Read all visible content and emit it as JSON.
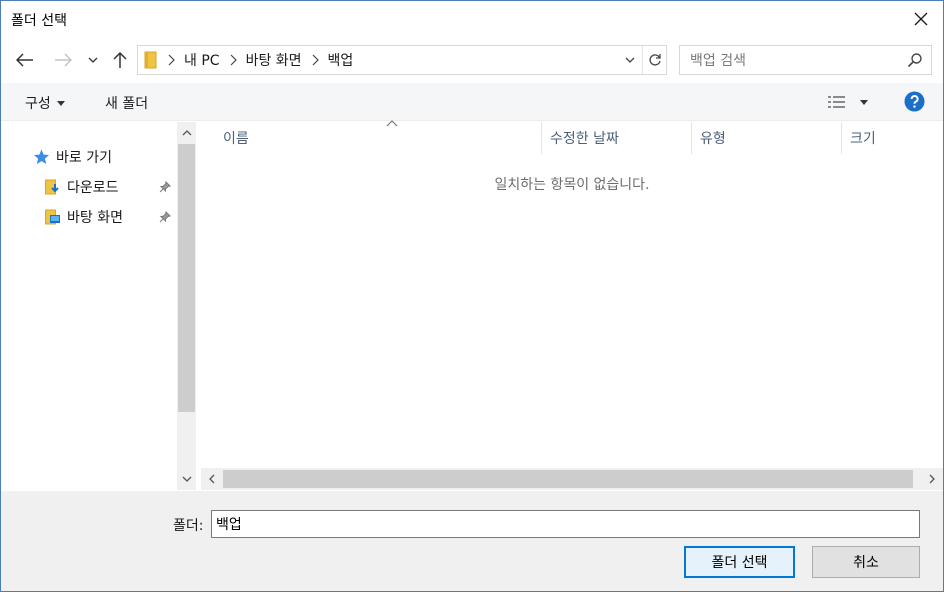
{
  "window": {
    "title": "폴더 선택"
  },
  "address": {
    "crumbs": [
      "내 PC",
      "바탕 화면",
      "백업"
    ]
  },
  "search": {
    "placeholder": "백업 검색"
  },
  "toolbar": {
    "organize_label": "구성",
    "new_folder_label": "새 폴더"
  },
  "nav": {
    "items": [
      {
        "label": "바로 가기",
        "icon": "star-icon"
      },
      {
        "label": "다운로드",
        "icon": "download-folder-icon",
        "pinned": true
      },
      {
        "label": "바탕 화면",
        "icon": "desktop-folder-icon",
        "pinned": true
      }
    ]
  },
  "columns": [
    "이름",
    "수정한 날짜",
    "유형",
    "크기"
  ],
  "file_list": {
    "empty_message": "일치하는 항목이 없습니다."
  },
  "bottom": {
    "folder_label": "폴더:",
    "folder_value": "백업",
    "select_button": "폴더 선택",
    "cancel_button": "취소"
  },
  "colors": {
    "accent": "#0078d7",
    "help": "#1a6fc9",
    "star": "#3a8ee6",
    "folder": "#f0c442"
  }
}
